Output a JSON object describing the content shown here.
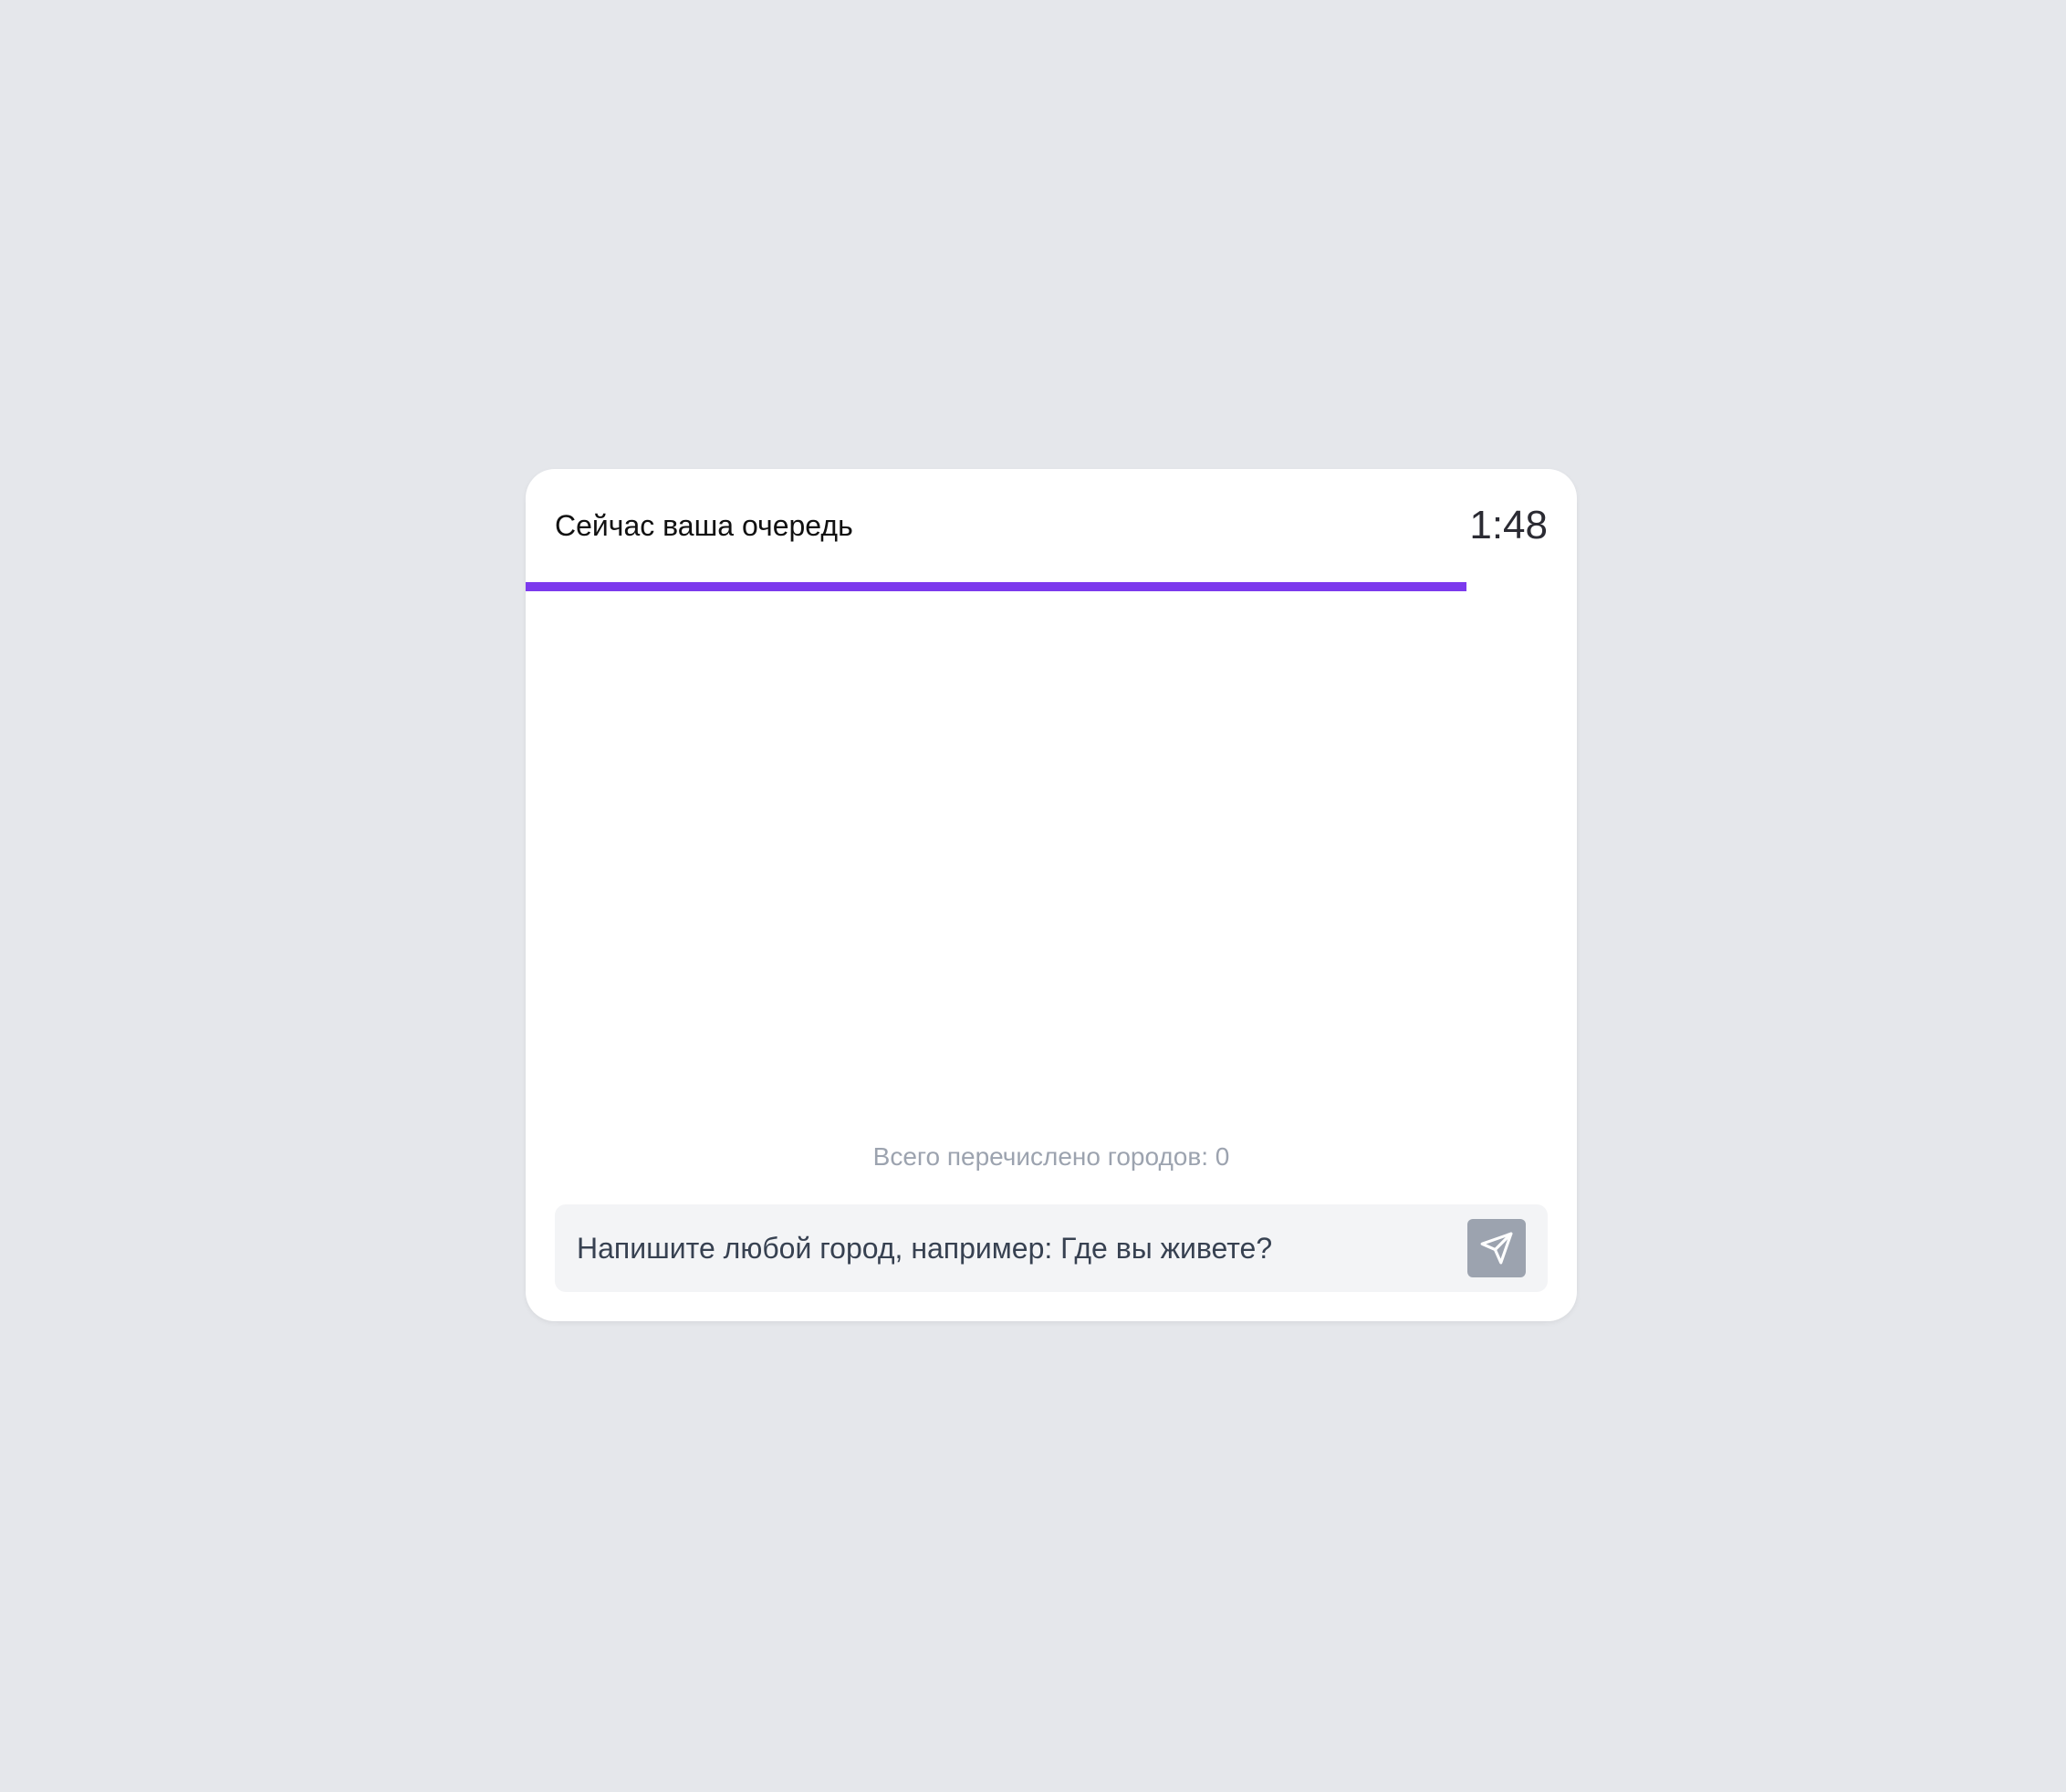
{
  "header": {
    "turn_label": "Сейчас ваша очередь",
    "timer": "1:48"
  },
  "progress": {
    "fraction": 0.895,
    "color": "#7c3aed"
  },
  "footer": {
    "count_text": "Всего перечислено городов: 0"
  },
  "input": {
    "placeholder": "Напишите любой город, например: Где вы живете?",
    "value": ""
  },
  "send_button": {
    "icon": "send-icon",
    "color": "#9ca3af"
  },
  "colors": {
    "background": "#e5e7eb",
    "card": "#ffffff",
    "accent": "#7c3aed",
    "muted_text": "#9ca3af",
    "input_bg": "#f3f4f6"
  }
}
